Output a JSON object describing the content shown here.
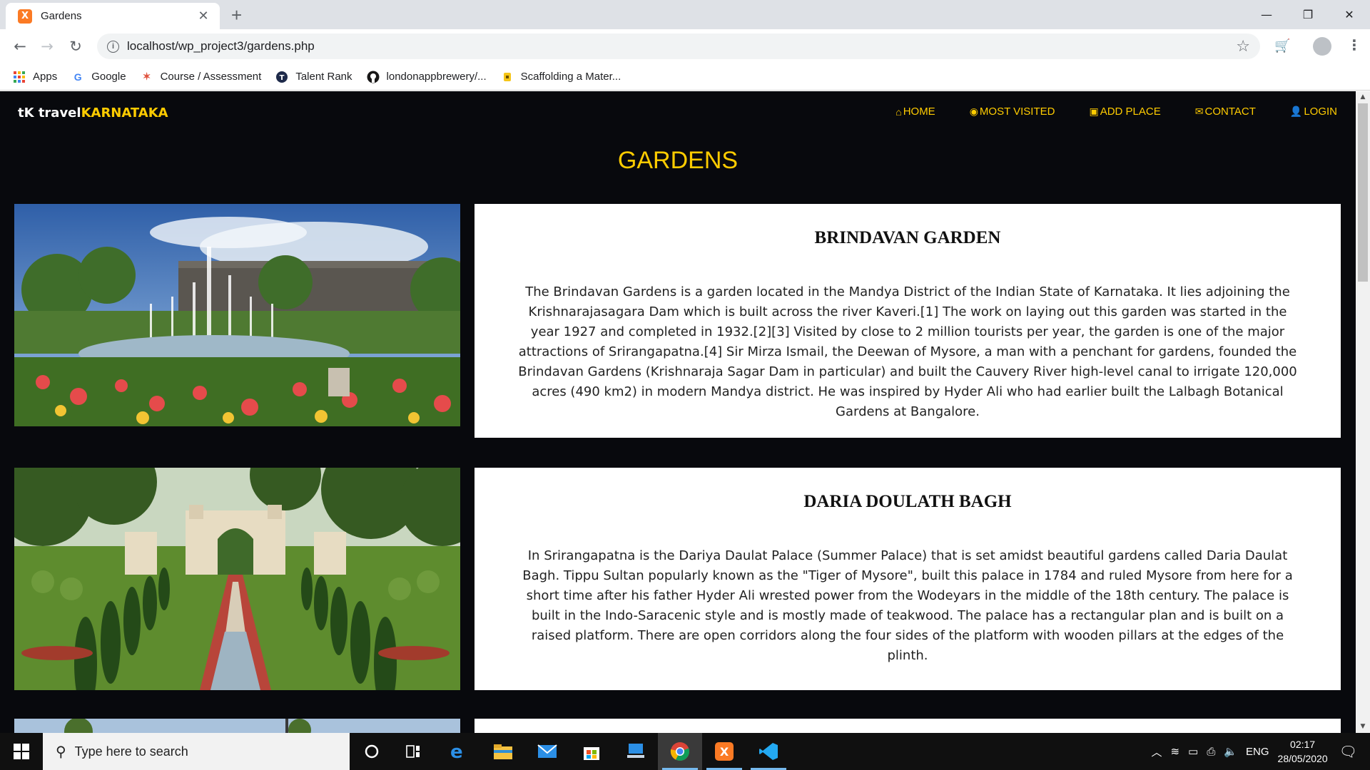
{
  "browser": {
    "tab_title": "Gardens",
    "tab_favicon": "X",
    "url": "localhost/wp_project3/gardens.php",
    "bookmarks": [
      {
        "label": "Apps",
        "icon": "apps-grid-icon"
      },
      {
        "label": "Google",
        "icon": "google-icon"
      },
      {
        "label": "Course / Assessment",
        "icon": "course-icon"
      },
      {
        "label": "Talent Rank",
        "icon": "talent-rank-icon"
      },
      {
        "label": "londonappbrewery/...",
        "icon": "github-icon"
      },
      {
        "label": "Scaffolding a Mater...",
        "icon": "scaffold-icon"
      }
    ]
  },
  "site": {
    "brand_prefix": "tK travel",
    "brand_accent": "KARNATAKA",
    "nav": [
      {
        "label": "HOME",
        "icon": "home-icon"
      },
      {
        "label": "MOST VISITED",
        "icon": "eye-icon"
      },
      {
        "label": "ADD PLACE",
        "icon": "camera-icon"
      },
      {
        "label": "CONTACT",
        "icon": "envelope-icon"
      },
      {
        "label": "LOGIN",
        "icon": "user-icon"
      }
    ],
    "page_title": "GARDENS",
    "accent_color": "#ffcc00",
    "background_color": "#08090d"
  },
  "places": [
    {
      "name": "BRINDAVAN GARDEN",
      "description": "The Brindavan Gardens is a garden located in the Mandya District of the Indian State of Karnataka. It lies adjoining the Krishnarajasagara Dam which is built across the river Kaveri.[1] The work on laying out this garden was started in the year 1927 and completed in 1932.[2][3] Visited by close to 2 million tourists per year, the garden is one of the major attractions of Srirangapatna.[4] Sir Mirza Ismail, the Deewan of Mysore, a man with a penchant for gardens, founded the Brindavan Gardens (Krishnaraja Sagar Dam in particular) and built the Cauvery River high-level canal to irrigate 120,000 acres (490 km2) in modern Mandya district. He was inspired by Hyder Ali who had earlier built the Lalbagh Botanical Gardens at Bangalore."
    },
    {
      "name": "DARIA DOULATH BAGH",
      "description": "In Srirangapatna is the Dariya Daulat Palace (Summer Palace) that is set amidst beautiful gardens called Daria Daulat Bagh. Tippu Sultan popularly known as the \"Tiger of Mysore\", built this palace in 1784 and ruled Mysore from here for a short time after his father Hyder Ali wrested power from the Wodeyars in the middle of the 18th century. The palace is built in the Indo-Saracenic style and is mostly made of teakwood. The palace has a rectangular plan and is built on a raised platform. There are open corridors along the four sides of the platform with wooden pillars at the edges of the plinth."
    }
  ],
  "taskbar": {
    "search_placeholder": "Type here to search",
    "language": "ENG",
    "time": "02:17",
    "date": "28/05/2020"
  }
}
